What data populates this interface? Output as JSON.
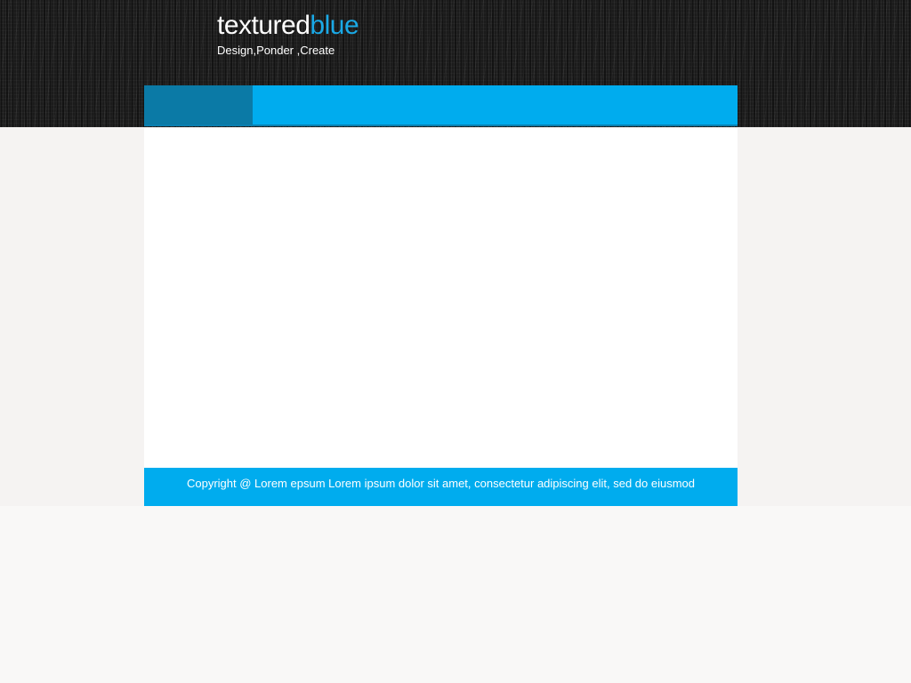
{
  "site": {
    "brand_primary": "textured",
    "brand_accent": "blue",
    "tagline": "Design,Ponder ,Create"
  },
  "colors": {
    "accent": "#00acee",
    "accent_dark": "#0b7aa6",
    "header_bg": "#1b1b1b",
    "page_bg": "#f5f3f2"
  },
  "navigation": {
    "active_item_label": ""
  },
  "footer": {
    "text": "Copyright @ Lorem epsum Lorem ipsum dolor sit amet, consectetur adipiscing elit, sed do eiusmod"
  }
}
